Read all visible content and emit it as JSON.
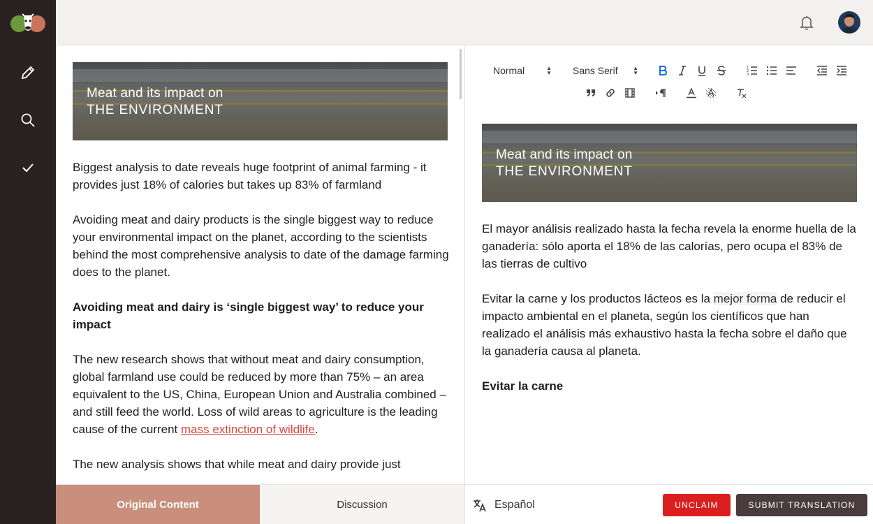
{
  "icons": {
    "logo": "cow-logo-icon",
    "edit": "pencil-icon",
    "search": "search-icon",
    "done": "checkmark-icon",
    "notifications": "bell-icon",
    "language": "translate-icon"
  },
  "colors": {
    "sidebar": "#2a2222",
    "topbar": "#f3f1f0",
    "accent_tab": "#c98f7c",
    "unclaim": "#db1f1f",
    "submit": "#4a3c3c",
    "link": "#d9483f",
    "bold_active": "#1a6fd4"
  },
  "original": {
    "banner_line1": "Meat and its impact on",
    "banner_line2": "THE ENVIRONMENT",
    "p1": "Biggest analysis to date reveals huge footprint of animal farming - it provides just 18% of calories but takes up 83% of farmland",
    "p2": "Avoiding meat and dairy products is the single biggest way to reduce your environmental impact on the planet, according to the scientists behind the most comprehensive analysis to date of the damage farming does to the planet.",
    "heading": "Avoiding meat and dairy is ‘single biggest way’ to reduce your impact",
    "p3": "The new research shows that without meat and dairy consumption, global farmland use could be reduced by more than 75% – an area equivalent to the US, China, European Union and Australia combined – and still feed the world. Loss of wild areas to agriculture is the leading cause of the current",
    "p3_link": "mass extinction of wildlife",
    "p3_end": ".",
    "p4": "The new analysis shows that while meat and dairy provide just"
  },
  "editor": {
    "toolbar": {
      "format": "Normal",
      "font": "Sans Serif"
    },
    "banner_line1": "Meat and its impact on",
    "banner_line2": "THE ENVIRONMENT",
    "p1": "El mayor análisis realizado hasta la fecha revela la enorme huella de la ganadería: sólo aporta el 18% de las calorías, pero ocupa el 83% de las tierras de cultivo",
    "p2_start": "Evitar la carne y los productos lácteos es la ",
    "p2_highlight": "mejor forma",
    "p2_end": " de reducir el impacto ambiental en el planeta, según los científicos que han realizado el análisis más exhaustivo hasta la fecha sobre el daño que la ganadería causa al planeta.",
    "heading": "Evitar la carne"
  },
  "footer": {
    "tab_original": "Original Content",
    "tab_discussion": "Discussion",
    "language": "Español",
    "unclaim": "UNCLAIM",
    "submit": "SUBMIT TRANSLATION"
  }
}
